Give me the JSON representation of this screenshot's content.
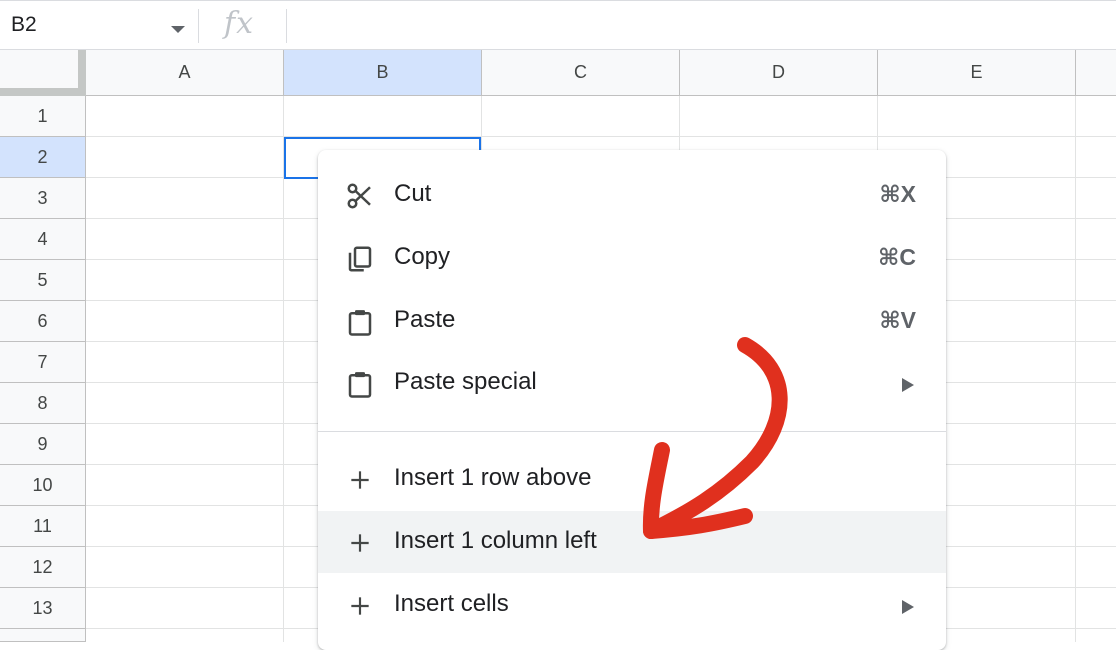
{
  "formula_bar": {
    "name_box": "B2",
    "fx_symbol": "fx"
  },
  "columns": [
    "A",
    "B",
    "C",
    "D",
    "E"
  ],
  "rows": [
    "1",
    "2",
    "3",
    "4",
    "5",
    "6",
    "7",
    "8",
    "9",
    "10",
    "11",
    "12",
    "13"
  ],
  "selection": {
    "column": "B",
    "row": "2"
  },
  "context_menu": {
    "items": [
      {
        "label": "Cut",
        "shortcut": "⌘X",
        "icon": "scissors-icon"
      },
      {
        "label": "Copy",
        "shortcut": "⌘C",
        "icon": "copy-icon"
      },
      {
        "label": "Paste",
        "shortcut": "⌘V",
        "icon": "clipboard-icon"
      },
      {
        "label": "Paste special",
        "icon": "clipboard-icon",
        "submenu": true
      },
      {
        "label": "Insert 1 row above",
        "icon": "plus-icon"
      },
      {
        "label": "Insert 1 column left",
        "icon": "plus-icon",
        "highlighted": true
      },
      {
        "label": "Insert cells",
        "icon": "plus-icon",
        "submenu": true
      }
    ]
  },
  "colors": {
    "selection_border": "#1a73e8",
    "selected_header": "#d3e3fd",
    "hover_item": "#f1f3f4",
    "annotation_arrow": "#e0301e"
  },
  "annotation": {
    "type": "hand-drawn-arrow",
    "color": "#e0301e",
    "points_to": "Insert 1 column left"
  }
}
